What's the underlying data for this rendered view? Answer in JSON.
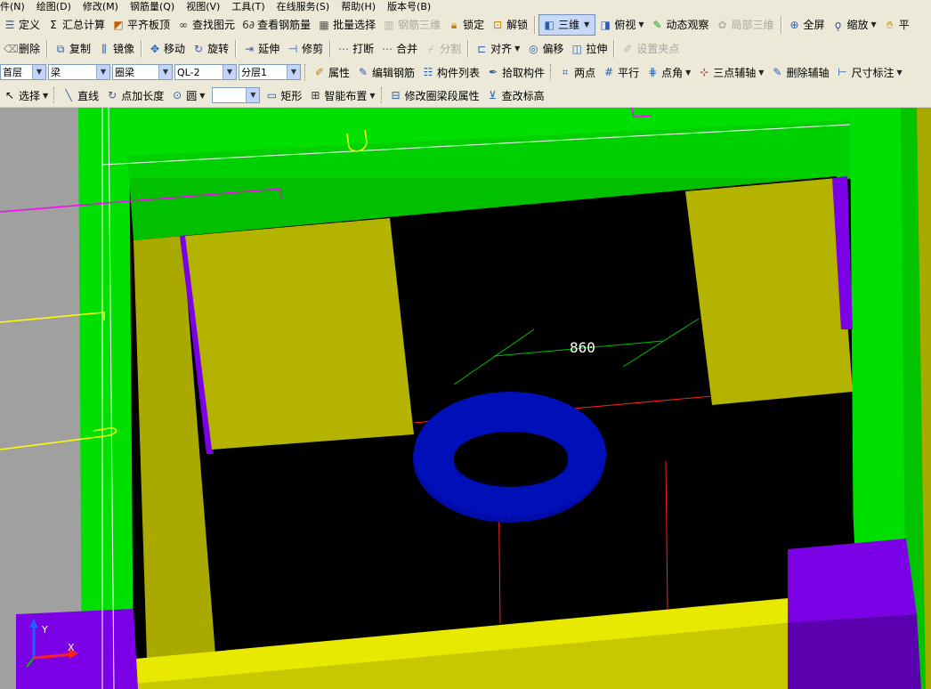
{
  "menu": [
    "件(N)",
    "绘图(D)",
    "修改(M)",
    "钢筋量(Q)",
    "视图(V)",
    "工具(T)",
    "在线服务(S)",
    "帮助(H)",
    "版本号(B)"
  ],
  "toolbar1": {
    "define": "定义",
    "summary_calc": "汇总计算",
    "align_slab_top": "平齐板顶",
    "find_element": "查找图元",
    "view_rebar_qty": "查看钢筋量",
    "batch_select": "批量选择",
    "rebar_3d": "钢筋三维",
    "lock": "锁定",
    "unlock": "解锁",
    "view_3d": "三维",
    "top_view": "俯视",
    "dynamic_observe": "动态观察",
    "local_3d": "局部三维",
    "fullscreen": "全屏",
    "zoom": "缩放",
    "pan": "平"
  },
  "toolbar2": {
    "delete": "删除",
    "copy": "复制",
    "mirror": "镜像",
    "move": "移动",
    "rotate": "旋转",
    "extend": "延伸",
    "trim": "修剪",
    "break": "打断",
    "merge": "合并",
    "split": "分割",
    "align": "对齐",
    "offset": "偏移",
    "stretch": "拉伸",
    "set_grip": "设置夹点"
  },
  "toolbar3": {
    "floor": "首层",
    "category": "梁",
    "type": "圈梁",
    "component": "QL-2",
    "layer": "分层1",
    "properties": "属性",
    "edit_rebar": "编辑钢筋",
    "component_list": "构件列表",
    "pick_component": "拾取构件",
    "two_points": "两点",
    "parallel": "平行",
    "point_angle": "点角",
    "three_point_axis": "三点辅轴",
    "delete_axis": "删除辅轴",
    "dimension": "尺寸标注"
  },
  "toolbar4": {
    "select": "选择",
    "line": "直线",
    "point_length": "点加长度",
    "circle": "圆",
    "circle_value": "",
    "rectangle": "矩形",
    "smart_layout": "智能布置",
    "modify_ring_beam": "修改圈梁段属性",
    "check_elevation": "查改标高"
  },
  "viewport": {
    "dimension_label": "860",
    "axis_y_label": "Y",
    "axis_x_label": "X",
    "colors": {
      "background": "#000000",
      "green": "#00e000",
      "dark_green": "#00b800",
      "olive": "#b3b300",
      "yellow": "#e8e800",
      "purple": "#7b00e6",
      "blue": "#000ca8",
      "gray": "#a0a0a0"
    }
  }
}
